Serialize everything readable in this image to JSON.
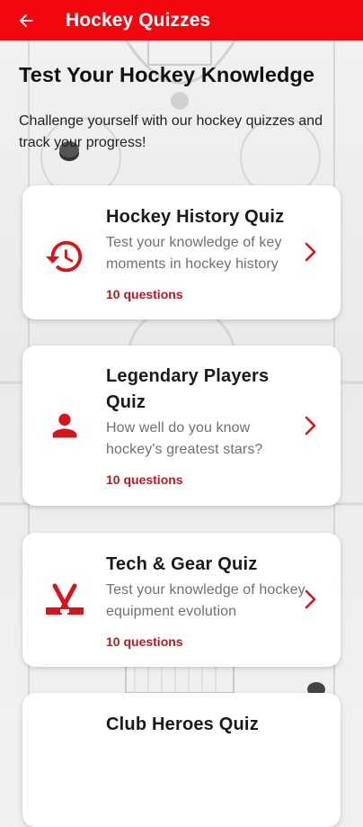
{
  "app_bar": {
    "title": "Hockey Quizzes",
    "back_icon": "arrow-left-icon",
    "background": "#f2070f"
  },
  "header": {
    "title": "Test Your Hockey Knowledge",
    "subtitle": "Challenge yourself with our hockey quizzes and track your progress!"
  },
  "quizzes": [
    {
      "title": "Hockey History Quiz",
      "description": "Test your knowledge of key moments in hockey history",
      "count": "10 questions",
      "icon": "history-clock-icon"
    },
    {
      "title": "Legendary Players Quiz",
      "description": "How well do you know hockey's greatest stars?",
      "count": "10 questions",
      "icon": "person-icon"
    },
    {
      "title": "Tech & Gear Quiz",
      "description": "Test your knowledge of hockey equipment evolution",
      "count": "10 questions",
      "icon": "hockey-sticks-icon"
    },
    {
      "title": "Club Heroes Quiz",
      "description": "",
      "count": "",
      "icon": ""
    }
  ],
  "colors": {
    "accent": "#d8141b",
    "count_text": "#c8141b",
    "card_bg": "#ffffff"
  }
}
